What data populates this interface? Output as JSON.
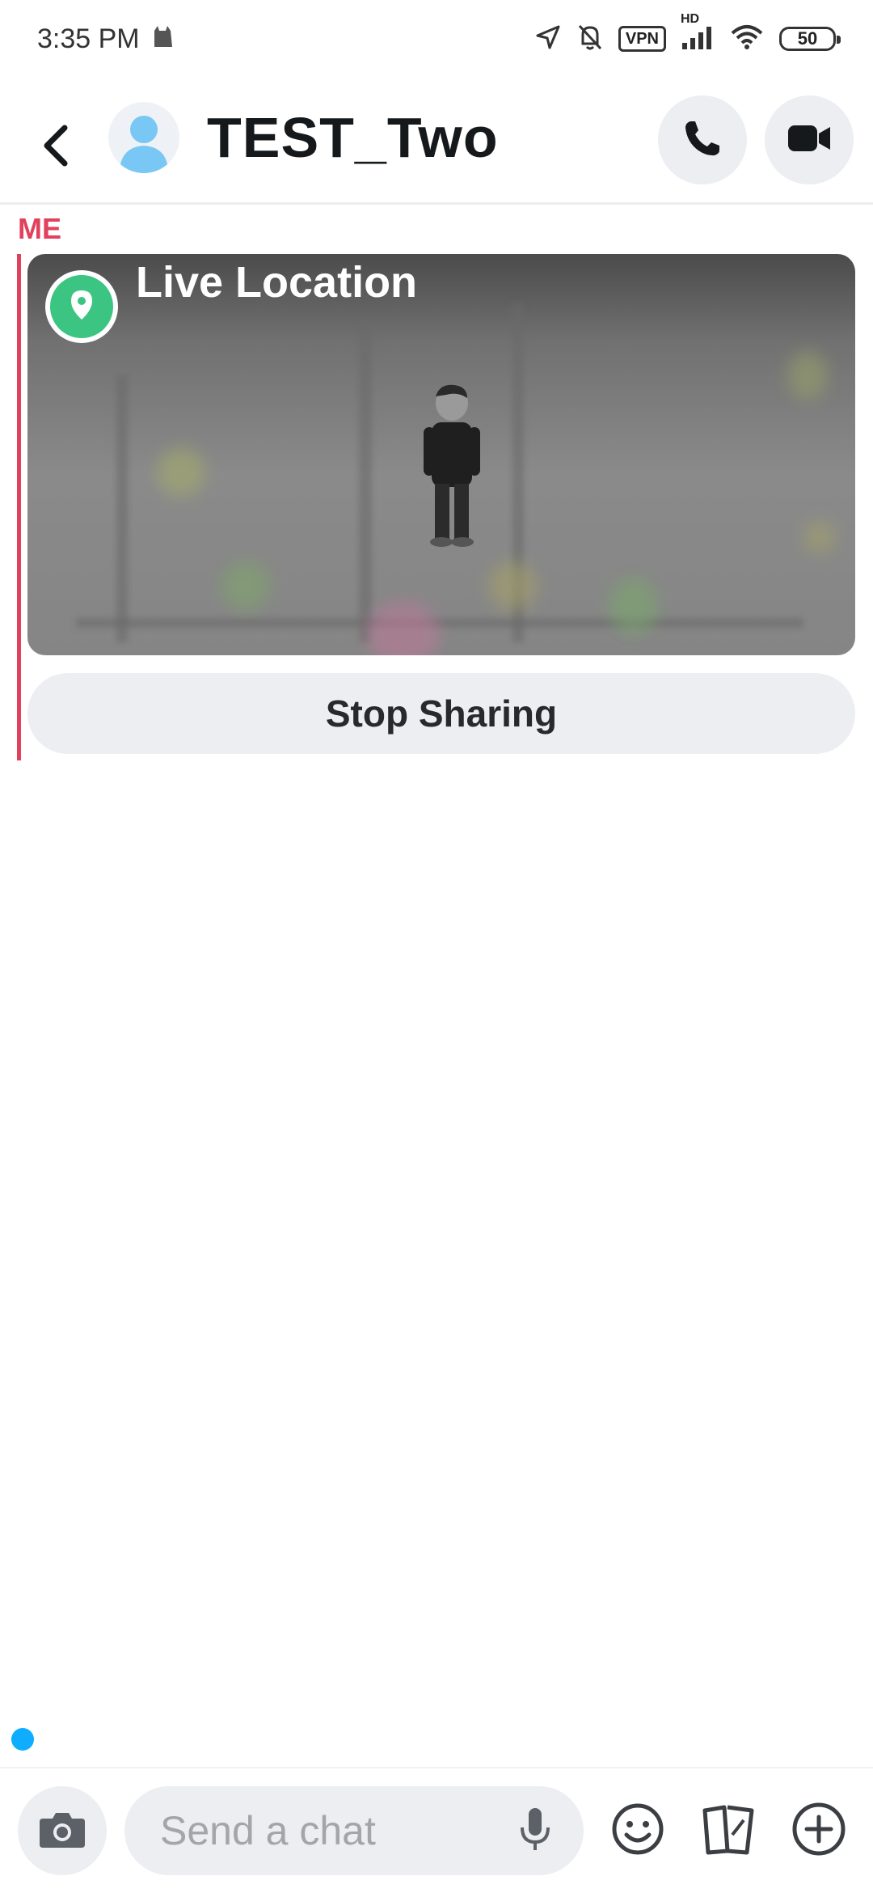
{
  "status_bar": {
    "time": "3:35 PM",
    "vpn": "VPN",
    "network": "HD",
    "battery": "50",
    "icons": [
      "cat-icon",
      "location-arrow-icon",
      "bell-muted-icon",
      "vpn-icon",
      "signal-icon",
      "wifi-icon",
      "battery-icon"
    ]
  },
  "header": {
    "title": "TEST_Two",
    "icons": [
      "back-arrow-icon",
      "avatar-silhouette-icon",
      "phone-icon",
      "video-camera-icon"
    ]
  },
  "chat": {
    "sender_label": "ME",
    "sender_color": "#e1415d",
    "message": {
      "type": "live-location",
      "title": "Live Location",
      "pin_color": "#3cc482",
      "action_label": "Stop Sharing"
    }
  },
  "composer": {
    "placeholder": "Send a chat",
    "icons": [
      "camera-icon",
      "microphone-icon",
      "smiley-icon",
      "sticker-cards-icon",
      "plus-circle-icon"
    ]
  },
  "colors": {
    "accent_red": "#e1415d",
    "typing_indicator": "#0eadff",
    "button_bg": "#eceef1"
  }
}
